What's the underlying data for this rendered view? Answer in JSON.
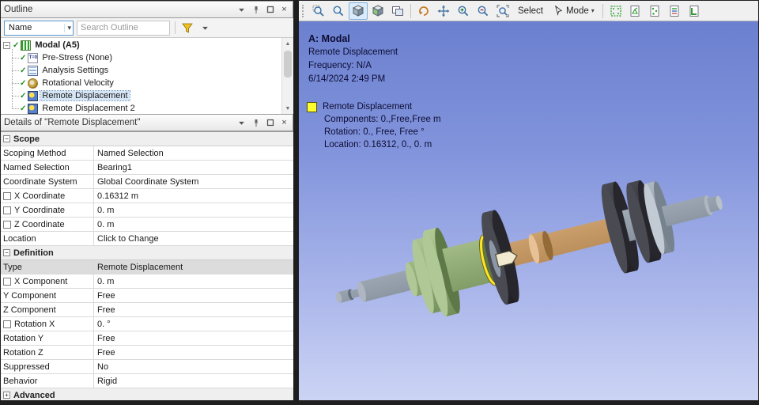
{
  "outline": {
    "title": "Outline",
    "toolbar": {
      "name_label": "Name",
      "search_placeholder": "Search Outline"
    },
    "tree": {
      "root_label": "Modal (A5)",
      "items": [
        {
          "label": "Pre-Stress (None)",
          "icon": "pre-stress-icon",
          "selected": false
        },
        {
          "label": "Analysis Settings",
          "icon": "analysis-settings-icon",
          "selected": false
        },
        {
          "label": "Rotational Velocity",
          "icon": "rotational-velocity-icon",
          "selected": false
        },
        {
          "label": "Remote Displacement",
          "icon": "remote-displacement-icon",
          "selected": true
        },
        {
          "label": "Remote Displacement 2",
          "icon": "remote-displacement-icon",
          "selected": false
        }
      ]
    }
  },
  "details": {
    "title": "Details of \"Remote Displacement\"",
    "rows": [
      {
        "type": "section",
        "label": "Scope",
        "collapsed": false
      },
      {
        "label": "Scoping Method",
        "value": "Named Selection"
      },
      {
        "label": "Named Selection",
        "value": "Bearing1"
      },
      {
        "label": "Coordinate System",
        "value": "Global Coordinate System"
      },
      {
        "label": "X Coordinate",
        "value": "0.16312 m",
        "checkbox": true
      },
      {
        "label": "Y Coordinate",
        "value": "0. m",
        "checkbox": true
      },
      {
        "label": "Z Coordinate",
        "value": "0. m",
        "checkbox": true
      },
      {
        "label": "Location",
        "value": "Click to Change"
      },
      {
        "type": "section",
        "label": "Definition",
        "collapsed": false
      },
      {
        "label": "Type",
        "value": "Remote Displacement",
        "selected": true
      },
      {
        "label": "X Component",
        "value": "0. m",
        "checkbox": true
      },
      {
        "label": "Y Component",
        "value": "Free"
      },
      {
        "label": "Z Component",
        "value": "Free"
      },
      {
        "label": "Rotation X",
        "value": "0. °",
        "checkbox": true
      },
      {
        "label": "Rotation Y",
        "value": "Free"
      },
      {
        "label": "Rotation Z",
        "value": "Free"
      },
      {
        "label": "Suppressed",
        "value": "No"
      },
      {
        "label": "Behavior",
        "value": "Rigid"
      },
      {
        "type": "section",
        "label": "Advanced",
        "collapsed": true
      }
    ]
  },
  "viewport": {
    "annotation_lines": [
      "A: Modal",
      "Remote Displacement",
      "Frequency: N/A",
      "6/14/2024 2:49 PM"
    ],
    "legend": {
      "title": "Remote Displacement",
      "swatch_color": "#ffff2e",
      "lines": [
        "Components: 0.,Free,Free m",
        "Rotation: 0., Free, Free °",
        "Location: 0.16312, 0., 0. m"
      ]
    },
    "background_top": "#6b80cf",
    "background_bottom": "#ccd4f4"
  },
  "toolbar": {
    "select_label": "Select",
    "mode_label": "Mode"
  }
}
